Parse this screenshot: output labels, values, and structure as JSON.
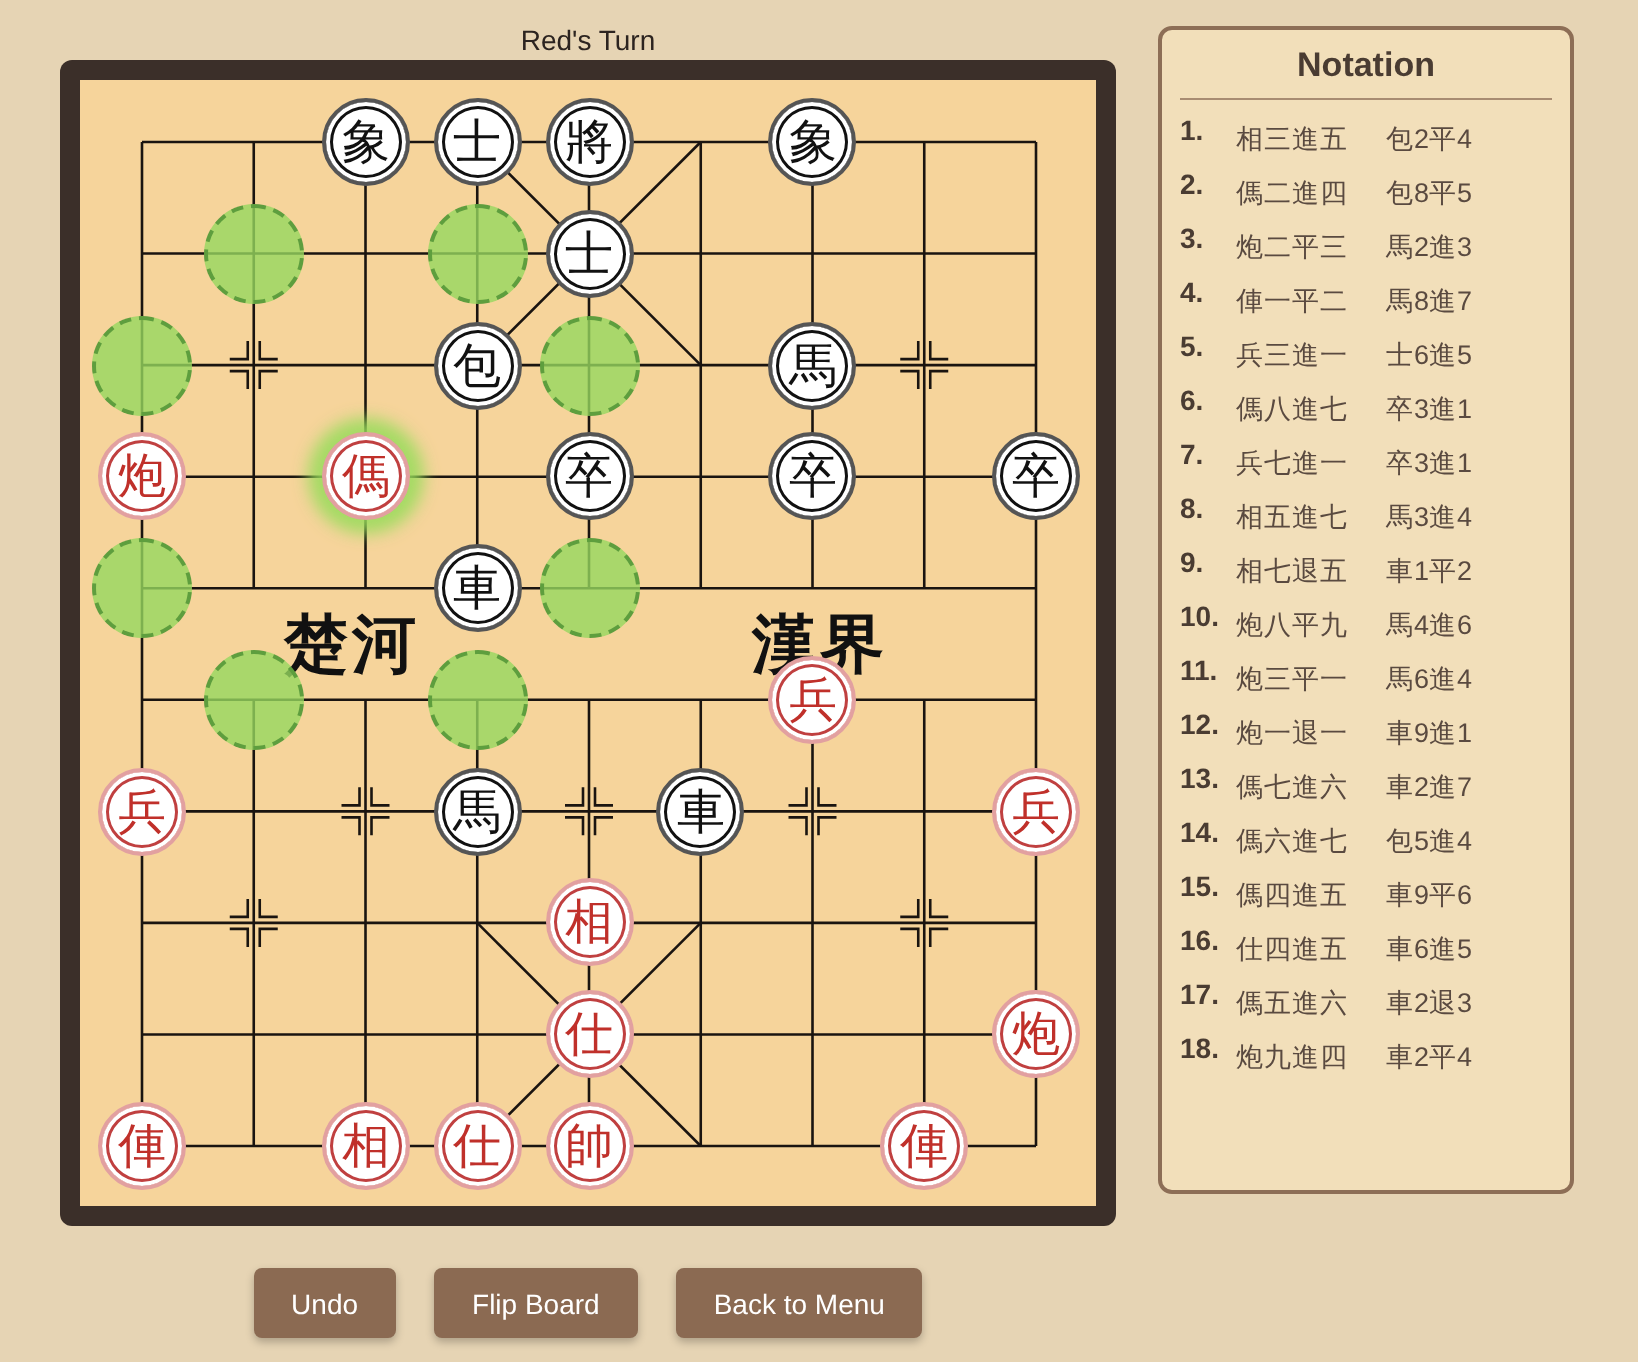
{
  "turn_label": "Red's Turn",
  "board": {
    "river_left": "楚河",
    "river_right": "漢界",
    "rows": [
      [
        {
          "kind": "empty"
        },
        {
          "kind": "empty"
        },
        {
          "kind": "piece",
          "red": false,
          "label": "象",
          "selected": false
        },
        {
          "kind": "piece",
          "red": false,
          "label": "士",
          "selected": false
        },
        {
          "kind": "piece",
          "red": false,
          "label": "將",
          "selected": false
        },
        {
          "kind": "empty"
        },
        {
          "kind": "piece",
          "red": false,
          "label": "象",
          "selected": false
        },
        {
          "kind": "empty"
        },
        {
          "kind": "empty"
        }
      ],
      [
        {
          "kind": "empty"
        },
        {
          "kind": "hint"
        },
        {
          "kind": "empty"
        },
        {
          "kind": "hint"
        },
        {
          "kind": "piece",
          "red": false,
          "label": "士",
          "selected": false
        },
        {
          "kind": "empty"
        },
        {
          "kind": "empty"
        },
        {
          "kind": "empty"
        },
        {
          "kind": "empty"
        }
      ],
      [
        {
          "kind": "hint"
        },
        {
          "kind": "empty"
        },
        {
          "kind": "empty"
        },
        {
          "kind": "piece",
          "red": false,
          "label": "包",
          "selected": false
        },
        {
          "kind": "hint"
        },
        {
          "kind": "empty"
        },
        {
          "kind": "piece",
          "red": false,
          "label": "馬",
          "selected": false
        },
        {
          "kind": "empty"
        },
        {
          "kind": "empty"
        }
      ],
      [
        {
          "kind": "piece",
          "red": true,
          "label": "炮",
          "selected": false
        },
        {
          "kind": "empty"
        },
        {
          "kind": "piece",
          "red": true,
          "label": "傌",
          "selected": true
        },
        {
          "kind": "empty"
        },
        {
          "kind": "piece",
          "red": false,
          "label": "卒",
          "selected": false
        },
        {
          "kind": "empty"
        },
        {
          "kind": "piece",
          "red": false,
          "label": "卒",
          "selected": false
        },
        {
          "kind": "empty"
        },
        {
          "kind": "piece",
          "red": false,
          "label": "卒",
          "selected": false
        }
      ],
      [
        {
          "kind": "hint"
        },
        {
          "kind": "empty"
        },
        {
          "kind": "empty"
        },
        {
          "kind": "piece",
          "red": false,
          "label": "車",
          "selected": false
        },
        {
          "kind": "hint"
        },
        {
          "kind": "empty"
        },
        {
          "kind": "empty"
        },
        {
          "kind": "empty"
        },
        {
          "kind": "empty"
        }
      ],
      [
        {
          "kind": "empty"
        },
        {
          "kind": "hint"
        },
        {
          "kind": "empty"
        },
        {
          "kind": "hint"
        },
        {
          "kind": "empty"
        },
        {
          "kind": "empty"
        },
        {
          "kind": "piece",
          "red": true,
          "label": "兵",
          "selected": false
        },
        {
          "kind": "empty"
        },
        {
          "kind": "empty"
        }
      ],
      [
        {
          "kind": "piece",
          "red": true,
          "label": "兵",
          "selected": false
        },
        {
          "kind": "empty"
        },
        {
          "kind": "empty"
        },
        {
          "kind": "piece",
          "red": false,
          "label": "馬",
          "selected": false
        },
        {
          "kind": "empty"
        },
        {
          "kind": "piece",
          "red": false,
          "label": "車",
          "selected": false
        },
        {
          "kind": "empty"
        },
        {
          "kind": "empty"
        },
        {
          "kind": "piece",
          "red": true,
          "label": "兵",
          "selected": false
        }
      ],
      [
        {
          "kind": "empty"
        },
        {
          "kind": "empty"
        },
        {
          "kind": "empty"
        },
        {
          "kind": "empty"
        },
        {
          "kind": "piece",
          "red": true,
          "label": "相",
          "selected": false
        },
        {
          "kind": "empty"
        },
        {
          "kind": "empty"
        },
        {
          "kind": "empty"
        },
        {
          "kind": "empty"
        }
      ],
      [
        {
          "kind": "empty"
        },
        {
          "kind": "empty"
        },
        {
          "kind": "empty"
        },
        {
          "kind": "empty"
        },
        {
          "kind": "piece",
          "red": true,
          "label": "仕",
          "selected": false
        },
        {
          "kind": "empty"
        },
        {
          "kind": "empty"
        },
        {
          "kind": "empty"
        },
        {
          "kind": "piece",
          "red": true,
          "label": "炮",
          "selected": false
        }
      ],
      [
        {
          "kind": "piece",
          "red": true,
          "label": "俥",
          "selected": false
        },
        {
          "kind": "empty"
        },
        {
          "kind": "piece",
          "red": true,
          "label": "相",
          "selected": false
        },
        {
          "kind": "piece",
          "red": true,
          "label": "仕",
          "selected": false
        },
        {
          "kind": "piece",
          "red": true,
          "label": "帥",
          "selected": false
        },
        {
          "kind": "empty"
        },
        {
          "kind": "empty"
        },
        {
          "kind": "piece",
          "red": true,
          "label": "俥",
          "selected": false
        },
        {
          "kind": "empty"
        }
      ]
    ]
  },
  "buttons": [
    "Undo",
    "Flip Board",
    "Back to Menu"
  ],
  "notation": {
    "title": "Notation",
    "moves": [
      {
        "number": "1.",
        "red": "相三進五",
        "black": "包2平4"
      },
      {
        "number": "2.",
        "red": "傌二進四",
        "black": "包8平5"
      },
      {
        "number": "3.",
        "red": "炮二平三",
        "black": "馬2進3"
      },
      {
        "number": "4.",
        "red": "俥一平二",
        "black": "馬8進7"
      },
      {
        "number": "5.",
        "red": "兵三進一",
        "black": "士6進5"
      },
      {
        "number": "6.",
        "red": "傌八進七",
        "black": "卒3進1"
      },
      {
        "number": "7.",
        "red": "兵七進一",
        "black": "卒3進1"
      },
      {
        "number": "8.",
        "red": "相五進七",
        "black": "馬3進4"
      },
      {
        "number": "9.",
        "red": "相七退五",
        "black": "車1平2"
      },
      {
        "number": "10.",
        "red": "炮八平九",
        "black": "馬4進6"
      },
      {
        "number": "11.",
        "red": "炮三平一",
        "black": "馬6進4"
      },
      {
        "number": "12.",
        "red": "炮一退一",
        "black": "車9進1"
      },
      {
        "number": "13.",
        "red": "傌七進六",
        "black": "車2進7"
      },
      {
        "number": "14.",
        "red": "傌六進七",
        "black": "包5進4"
      },
      {
        "number": "15.",
        "red": "傌四進五",
        "black": "車9平6"
      },
      {
        "number": "16.",
        "red": "仕四進五",
        "black": "車6進5"
      },
      {
        "number": "17.",
        "red": "傌五進六",
        "black": "車2退3"
      },
      {
        "number": "18.",
        "red": "炮九進四",
        "black": "車2平4"
      }
    ]
  }
}
